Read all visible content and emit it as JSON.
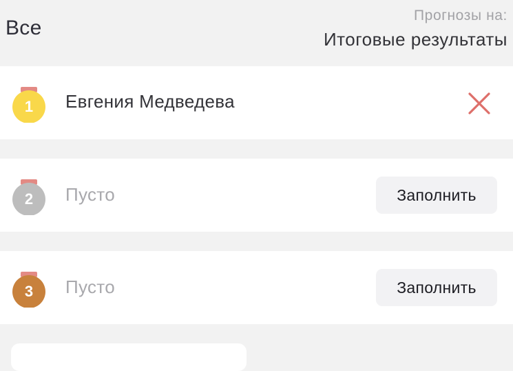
{
  "header": {
    "category_label": "Все",
    "forecast_caption": "Прогнозы на:",
    "forecast_value": "Итоговые результаты"
  },
  "places": [
    {
      "place": "1",
      "medal": "gold",
      "medal_color": "#f9d84a",
      "ribbon_color": "#e38a84",
      "athlete": "Евгения Медведева",
      "remove_icon": "close-icon",
      "remove_color": "#de6f6a"
    },
    {
      "place": "2",
      "medal": "silver",
      "medal_color": "#bdbdbd",
      "ribbon_color": "#e38a84",
      "empty_text": "Пусто",
      "fill_label": "Заполнить"
    },
    {
      "place": "3",
      "medal": "bronze",
      "medal_color": "#c8813c",
      "ribbon_color": "#e38a84",
      "empty_text": "Пусто",
      "fill_label": "Заполнить"
    }
  ]
}
